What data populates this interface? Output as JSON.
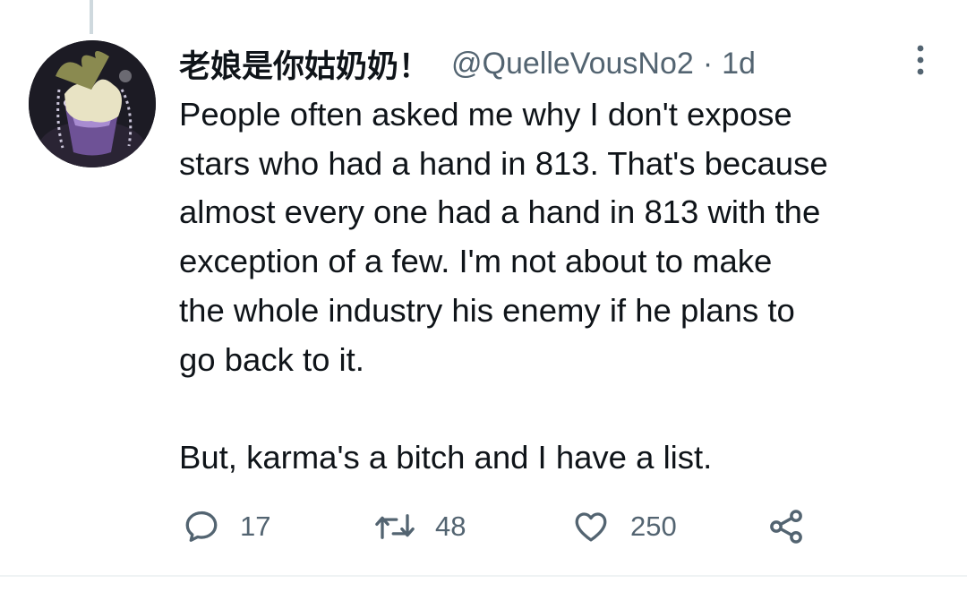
{
  "tweet": {
    "display_name": "老娘是你姑奶奶！",
    "handle": "@QuelleVousNo2",
    "separator": "·",
    "time": "1d",
    "text": "People often asked me why I don't expose\nstars who had a hand in 813. That's because\nalmost every one had a hand in 813 with the\nexception of a few. I'm not about to make\nthe whole industry his enemy if he plans to\ngo back to it.\n\nBut, karma's a bitch and I have a list.",
    "actions": {
      "reply_count": "17",
      "retweet_count": "48",
      "like_count": "250"
    }
  },
  "icons": {
    "more": "more-vertical-icon",
    "reply": "reply-icon",
    "retweet": "retweet-icon",
    "like": "heart-icon",
    "share": "share-icon"
  },
  "colors": {
    "text_primary": "#0f1419",
    "text_secondary": "#536471",
    "divider": "#eff3f4",
    "thread_line": "#cfd9de"
  }
}
